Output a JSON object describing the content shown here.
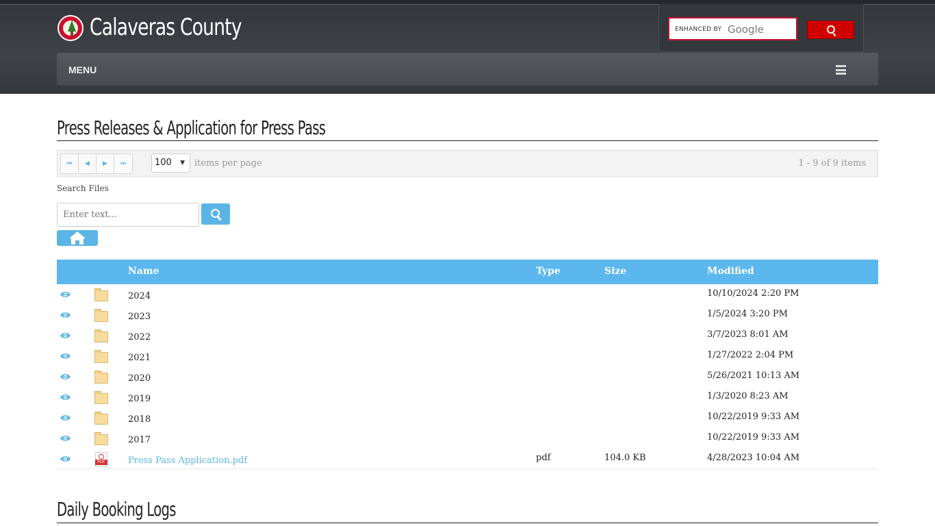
{
  "header": {
    "site_title": "Calaveras County",
    "search": {
      "enhanced_by": "ENHANCED BY",
      "provider": "Google"
    },
    "menu_label": "MENU"
  },
  "section1": {
    "title": "Press Releases & Application for Press Pass",
    "pager": {
      "page_size": "100",
      "items_per_page": "items per page",
      "info": "1 - 9 of 9 items"
    },
    "search_label": "Search Files",
    "search_placeholder": "Enter text...",
    "columns": {
      "name": "Name",
      "type": "Type",
      "size": "Size",
      "modified": "Modified"
    },
    "rows": [
      {
        "name": "2024",
        "type": "",
        "size": "",
        "modified": "10/10/2024 2:20 PM",
        "kind": "folder"
      },
      {
        "name": "2023",
        "type": "",
        "size": "",
        "modified": "1/5/2024 3:20 PM",
        "kind": "folder"
      },
      {
        "name": "2022",
        "type": "",
        "size": "",
        "modified": "3/7/2023 8:01 AM",
        "kind": "folder"
      },
      {
        "name": "2021",
        "type": "",
        "size": "",
        "modified": "1/27/2022 2:04 PM",
        "kind": "folder"
      },
      {
        "name": "2020",
        "type": "",
        "size": "",
        "modified": "5/26/2021 10:13 AM",
        "kind": "folder"
      },
      {
        "name": "2019",
        "type": "",
        "size": "",
        "modified": "1/3/2020 8:23 AM",
        "kind": "folder"
      },
      {
        "name": "2018",
        "type": "",
        "size": "",
        "modified": "10/22/2019 9:33 AM",
        "kind": "folder"
      },
      {
        "name": "2017",
        "type": "",
        "size": "",
        "modified": "10/22/2019 9:33 AM",
        "kind": "folder"
      },
      {
        "name": "Press Pass Application.pdf",
        "type": "pdf",
        "size": "104.0 KB",
        "modified": "4/28/2023 10:04 AM",
        "kind": "pdf",
        "pdf_label": "PDF"
      }
    ]
  },
  "section2": {
    "title": "Daily Booking Logs"
  },
  "icons": {
    "logo": "county-seal-icon",
    "view": "eye-icon",
    "folder": "folder-icon",
    "pdf": "pdf-file-icon",
    "search": "search-icon",
    "home": "home-icon",
    "menu": "hamburger-icon"
  },
  "colors": {
    "accent": "#5bb4e5",
    "header_bg": "#3e4349",
    "google_button": "#d10000"
  }
}
